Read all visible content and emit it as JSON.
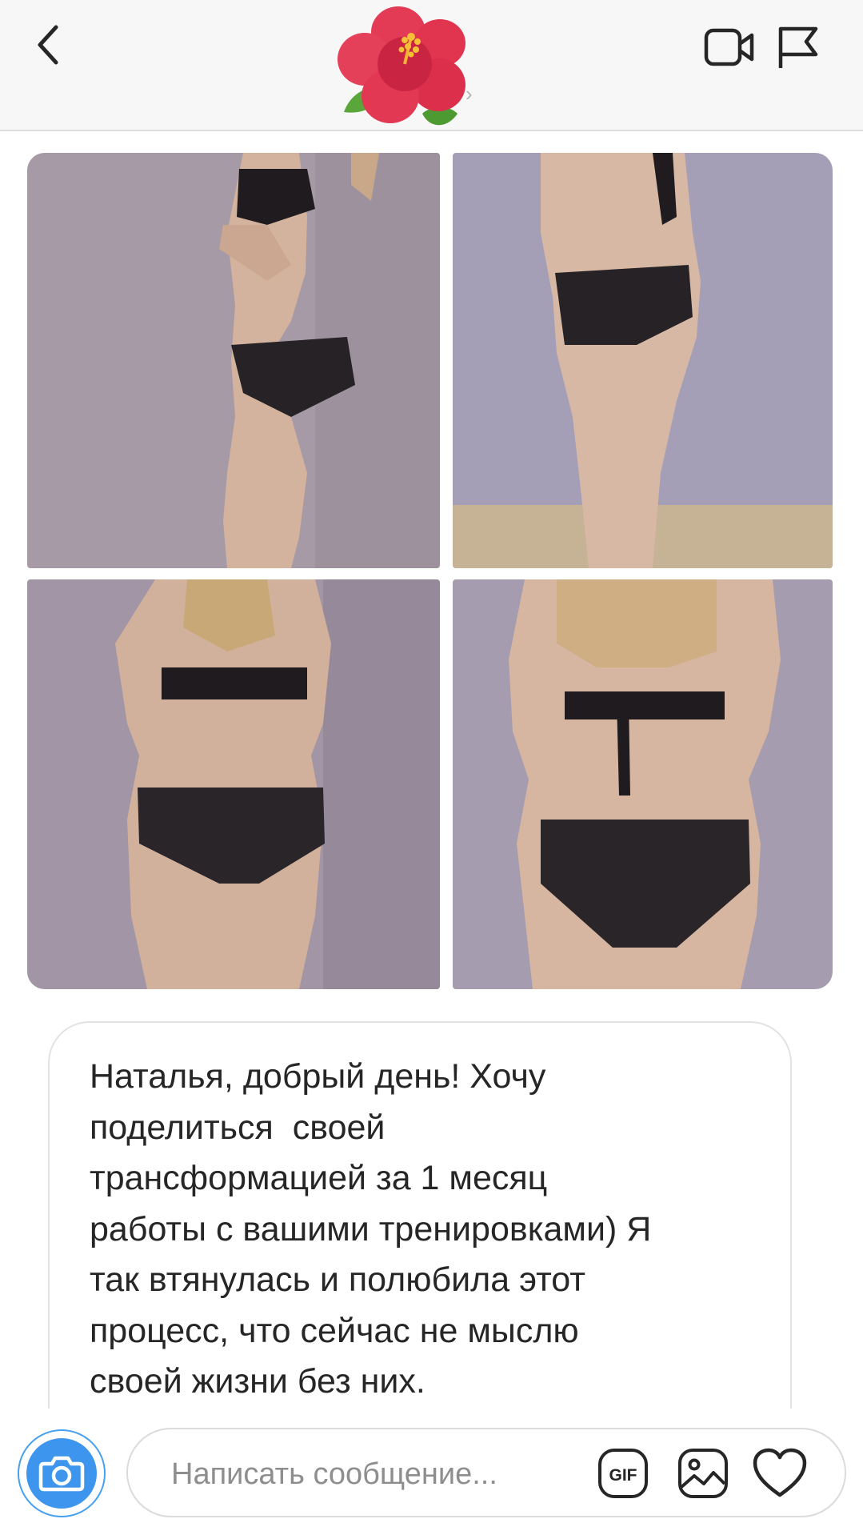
{
  "header": {
    "chevron": "›"
  },
  "message": {
    "text": "Наталья, добрый день! Хочу\nподелиться  своей\nтрансформацией за 1 месяц\nработы с вашими тренировками) Я\nтак втянулась и полюбила этот\nпроцесс, что сейчас не мыслю\nсвоей жизни без них."
  },
  "composer": {
    "placeholder": "Написать сообщение...",
    "gif_label": "GIF"
  },
  "icons": {
    "back": "back-chevron-icon",
    "avatar": "hibiscus-flower-avatar",
    "video": "video-camera-icon",
    "report": "flag-icon",
    "camera": "camera-icon",
    "gif": "gif-icon",
    "image": "image-icon",
    "heart": "heart-icon"
  },
  "colors": {
    "accent": "#3d95ee",
    "flower": "#e0344f",
    "header_bg": "#f7f7f7"
  }
}
